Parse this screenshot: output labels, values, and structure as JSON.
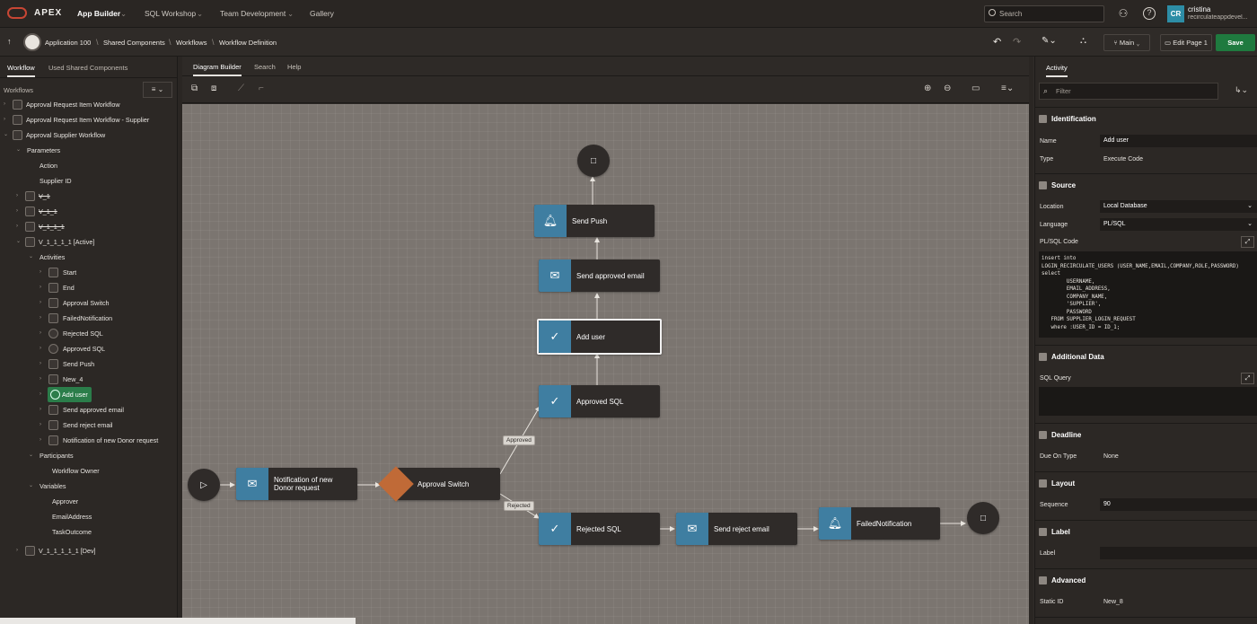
{
  "topbar": {
    "brand": "APEX",
    "nav": [
      "App Builder",
      "SQL Workshop",
      "Team Development",
      "Gallery"
    ],
    "search_placeholder": "Search",
    "user_initials": "CR",
    "user_name": "cristina",
    "user_org": "recirculateappdevel..."
  },
  "breadcrumb": {
    "items": [
      "Application 100",
      "Shared Components",
      "Workflows",
      "Workflow Definition"
    ],
    "main_label": "Main",
    "edit_label": "Edit Page 1",
    "save_label": "Save"
  },
  "left": {
    "tabs": [
      "Workflow",
      "Used Shared Components"
    ],
    "section_label": "Workflows",
    "tree": [
      {
        "label": "Approval Request Item Workflow",
        "level": 0
      },
      {
        "label": "Approval Request Item Workflow - Supplier",
        "level": 0
      },
      {
        "label": "Approval Supplier Workflow",
        "level": 0
      },
      {
        "label": "Parameters",
        "level": 1
      },
      {
        "label": "Action",
        "level": 2
      },
      {
        "label": "Supplier ID",
        "level": 2
      },
      {
        "label": "V_1",
        "level": 1
      },
      {
        "label": "V_1_1",
        "level": 1
      },
      {
        "label": "V_1_1_1",
        "level": 1
      },
      {
        "label": "V_1_1_1_1 [Active]",
        "level": 1
      },
      {
        "label": "Activities",
        "level": 2
      },
      {
        "label": "Start",
        "level": 3
      },
      {
        "label": "End",
        "level": 3
      },
      {
        "label": "Approval Switch",
        "level": 3
      },
      {
        "label": "FailedNotification",
        "level": 3
      },
      {
        "label": "Rejected SQL",
        "level": 3
      },
      {
        "label": "Approved SQL",
        "level": 3
      },
      {
        "label": "Send Push",
        "level": 3
      },
      {
        "label": "New_4",
        "level": 3
      },
      {
        "label": "Add user",
        "level": 3
      },
      {
        "label": "Send approved email",
        "level": 3
      },
      {
        "label": "Send reject email",
        "level": 3
      },
      {
        "label": "Notification of new Donor request",
        "level": 3
      },
      {
        "label": "Participants",
        "level": 2
      },
      {
        "label": "Workflow Owner",
        "level": 3
      },
      {
        "label": "Variables",
        "level": 2
      },
      {
        "label": "Approver",
        "level": 3
      },
      {
        "label": "EmailAddress",
        "level": 3
      },
      {
        "label": "TaskOutcome",
        "level": 3
      },
      {
        "label": "V_1_1_1_1_1 [Dev]",
        "level": 1
      }
    ]
  },
  "center": {
    "tabs": [
      "Diagram Builder",
      "Search",
      "Help"
    ],
    "nodes": {
      "send_push": "Send Push",
      "send_approved_email": "Send approved email",
      "add_user": "Add user",
      "approved_sql": "Approved SQL",
      "notification": "Notification of new Donor request",
      "approval_switch": "Approval Switch",
      "rejected_sql": "Rejected SQL",
      "send_reject_email": "Send reject email",
      "failed_notification": "FailedNotification"
    },
    "edge_labels": {
      "approved": "Approved",
      "rejected": "Rejected"
    }
  },
  "right": {
    "tab": "Activity",
    "filter_placeholder": "Filter",
    "identification": {
      "title": "Identification",
      "name_label": "Name",
      "name_value": "Add user",
      "type_label": "Type",
      "type_value": "Execute Code"
    },
    "source": {
      "title": "Source",
      "location_label": "Location",
      "location_value": "Local Database",
      "language_label": "Language",
      "language_value": "PL/SQL",
      "code_label": "PL/SQL Code",
      "code": "insert into\nLOGIN_RECIRCULATE_USERS (USER_NAME,EMAIL,COMPANY,ROLE,PASSWORD)\nselect\n        USERNAME,\n        EMAIL_ADDRESS,\n        COMPANY_NAME,\n        'SUPPLIER',\n        PASSWORD\n   FROM SUPPLIER_LOGIN_REQUEST\n   where :USER_ID = ID_1;"
    },
    "additional": {
      "title": "Additional Data",
      "sql_label": "SQL Query"
    },
    "deadline": {
      "title": "Deadline",
      "due_label": "Due On Type",
      "due_value": "None"
    },
    "layout": {
      "title": "Layout",
      "seq_label": "Sequence",
      "seq_value": "90"
    },
    "label": {
      "title": "Label",
      "label_label": "Label"
    },
    "advanced": {
      "title": "Advanced",
      "static_label": "Static ID",
      "static_value": "New_8"
    }
  }
}
